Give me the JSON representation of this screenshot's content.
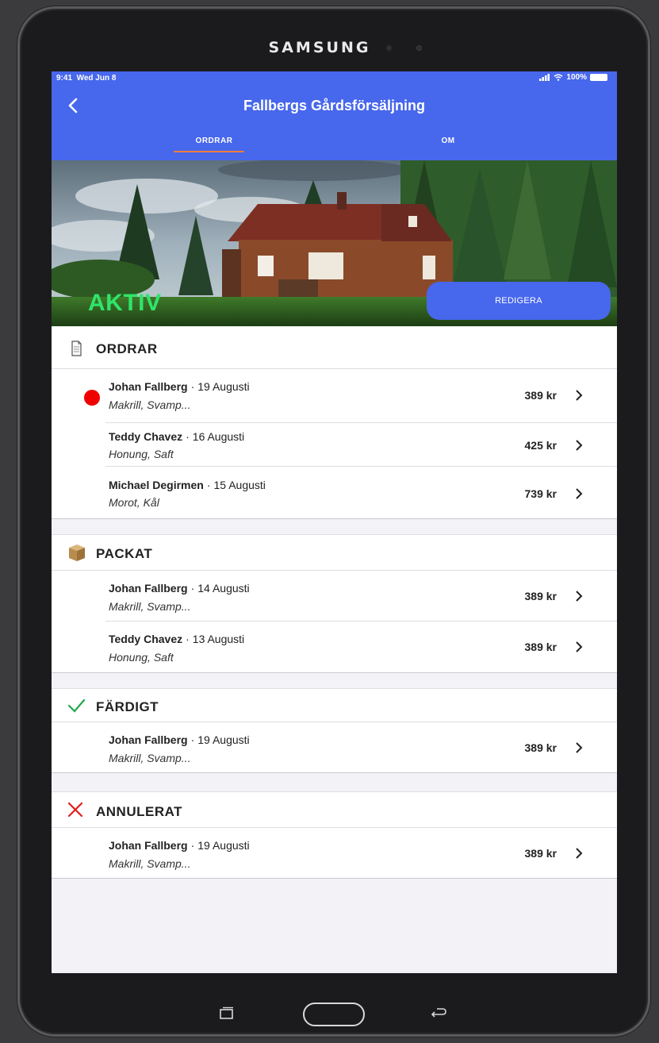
{
  "device": {
    "brand": "SAMSUNG"
  },
  "status_bar": {
    "time": "9:41",
    "date": "Wed Jun 8",
    "battery": "100%"
  },
  "header": {
    "title": "Fallbergs Gårdsförsäljning",
    "tabs": [
      {
        "label": "ORDRAR",
        "active": true
      },
      {
        "label": "OM",
        "active": false
      }
    ],
    "accent_color": "#4767ec",
    "tab_indicator_color": "#ff7b3a"
  },
  "hero": {
    "status_label": "AKTIV",
    "status_color": "#2ee56a",
    "edit_button": "REDIGERA"
  },
  "sections": [
    {
      "title": "ORDRAR",
      "icon": "document-icon",
      "orders": [
        {
          "name": "Johan Fallberg",
          "date": "19 Augusti",
          "items": "Makrill, Svamp...",
          "price": "389 kr",
          "unread": true
        },
        {
          "name": "Teddy Chavez",
          "date": "16 Augusti",
          "items": "Honung, Saft",
          "price": "425 kr"
        },
        {
          "name": "Michael Degirmen",
          "date": "15 Augusti",
          "items": "Morot, Kål",
          "price": "739 kr"
        }
      ]
    },
    {
      "title": "PACKAT",
      "icon": "package-icon",
      "orders": [
        {
          "name": "Johan Fallberg",
          "date": "14 Augusti",
          "items": "Makrill, Svamp...",
          "price": "389 kr"
        },
        {
          "name": "Teddy Chavez",
          "date": "13 Augusti",
          "items": "Honung, Saft",
          "price": "389 kr"
        }
      ]
    },
    {
      "title": "FÄRDIGT",
      "icon": "checkmark-icon",
      "orders": [
        {
          "name": "Johan Fallberg",
          "date": "19 Augusti",
          "items": "Makrill, Svamp...",
          "price": "389 kr"
        }
      ]
    },
    {
      "title": "ANNULERAT",
      "icon": "cross-icon",
      "orders": [
        {
          "name": "Johan Fallberg",
          "date": "19 Augusti",
          "items": "Makrill, Svamp...",
          "price": "389 kr"
        }
      ]
    }
  ],
  "dot_separator": "·"
}
